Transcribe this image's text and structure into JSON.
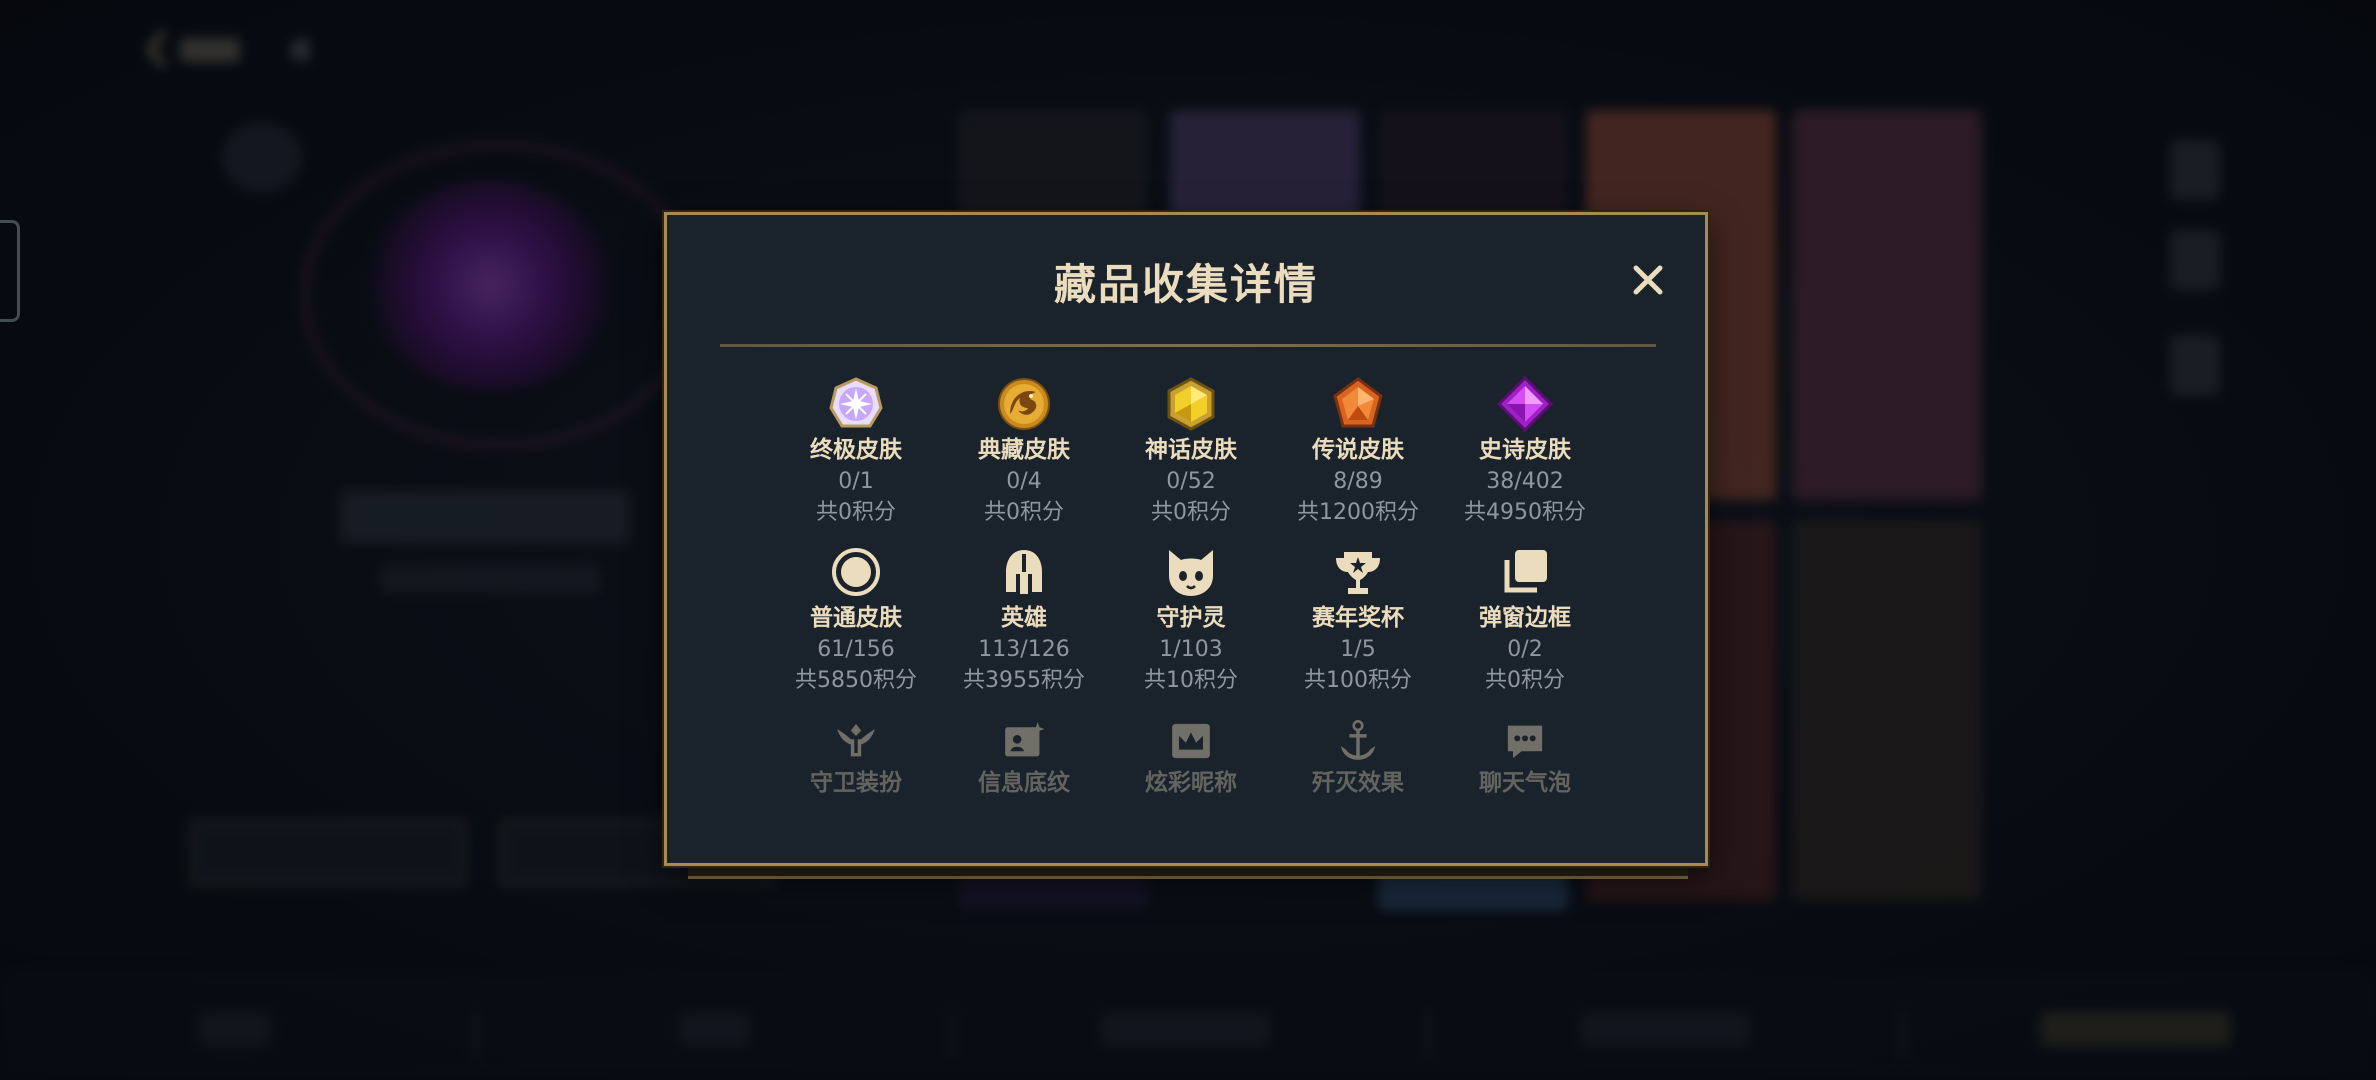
{
  "dialog": {
    "title": "藏品收集详情",
    "close_icon": "close-x-icon"
  },
  "colors": {
    "gold_border": "#a98b52",
    "title_text": "#eadcbc",
    "sub_text": "#8f969e",
    "dialog_bg": "#1a222c"
  },
  "items": [
    {
      "name": "终极皮肤",
      "count": "0/1",
      "points": "共0积分",
      "icon": "ultimate-skin-gem-icon"
    },
    {
      "name": "典藏皮肤",
      "count": "0/4",
      "points": "共0积分",
      "icon": "collection-skin-dragon-icon"
    },
    {
      "name": "神话皮肤",
      "count": "0/52",
      "points": "共0积分",
      "icon": "mythic-skin-gem-icon"
    },
    {
      "name": "传说皮肤",
      "count": "8/89",
      "points": "共1200积分",
      "icon": "legendary-skin-gem-icon"
    },
    {
      "name": "史诗皮肤",
      "count": "38/402",
      "points": "共4950积分",
      "icon": "epic-skin-gem-icon"
    },
    {
      "name": "普通皮肤",
      "count": "61/156",
      "points": "共5850积分",
      "icon": "normal-skin-circle-icon"
    },
    {
      "name": "英雄",
      "count": "113/126",
      "points": "共3955积分",
      "icon": "hero-helmet-icon"
    },
    {
      "name": "守护灵",
      "count": "1/103",
      "points": "共10积分",
      "icon": "guardian-spirit-icon"
    },
    {
      "name": "赛年奖杯",
      "count": "1/5",
      "points": "共100积分",
      "icon": "season-trophy-icon"
    },
    {
      "name": "弹窗边框",
      "count": "0/2",
      "points": "共0积分",
      "icon": "popup-frame-icon"
    },
    {
      "name": "守卫装扮",
      "icon": "ward-skin-icon"
    },
    {
      "name": "信息底纹",
      "icon": "info-card-icon"
    },
    {
      "name": "炫彩昵称",
      "icon": "colorful-nickname-icon"
    },
    {
      "name": "歼灭效果",
      "icon": "ace-effect-icon"
    },
    {
      "name": "聊天气泡",
      "icon": "chat-bubble-icon"
    }
  ]
}
